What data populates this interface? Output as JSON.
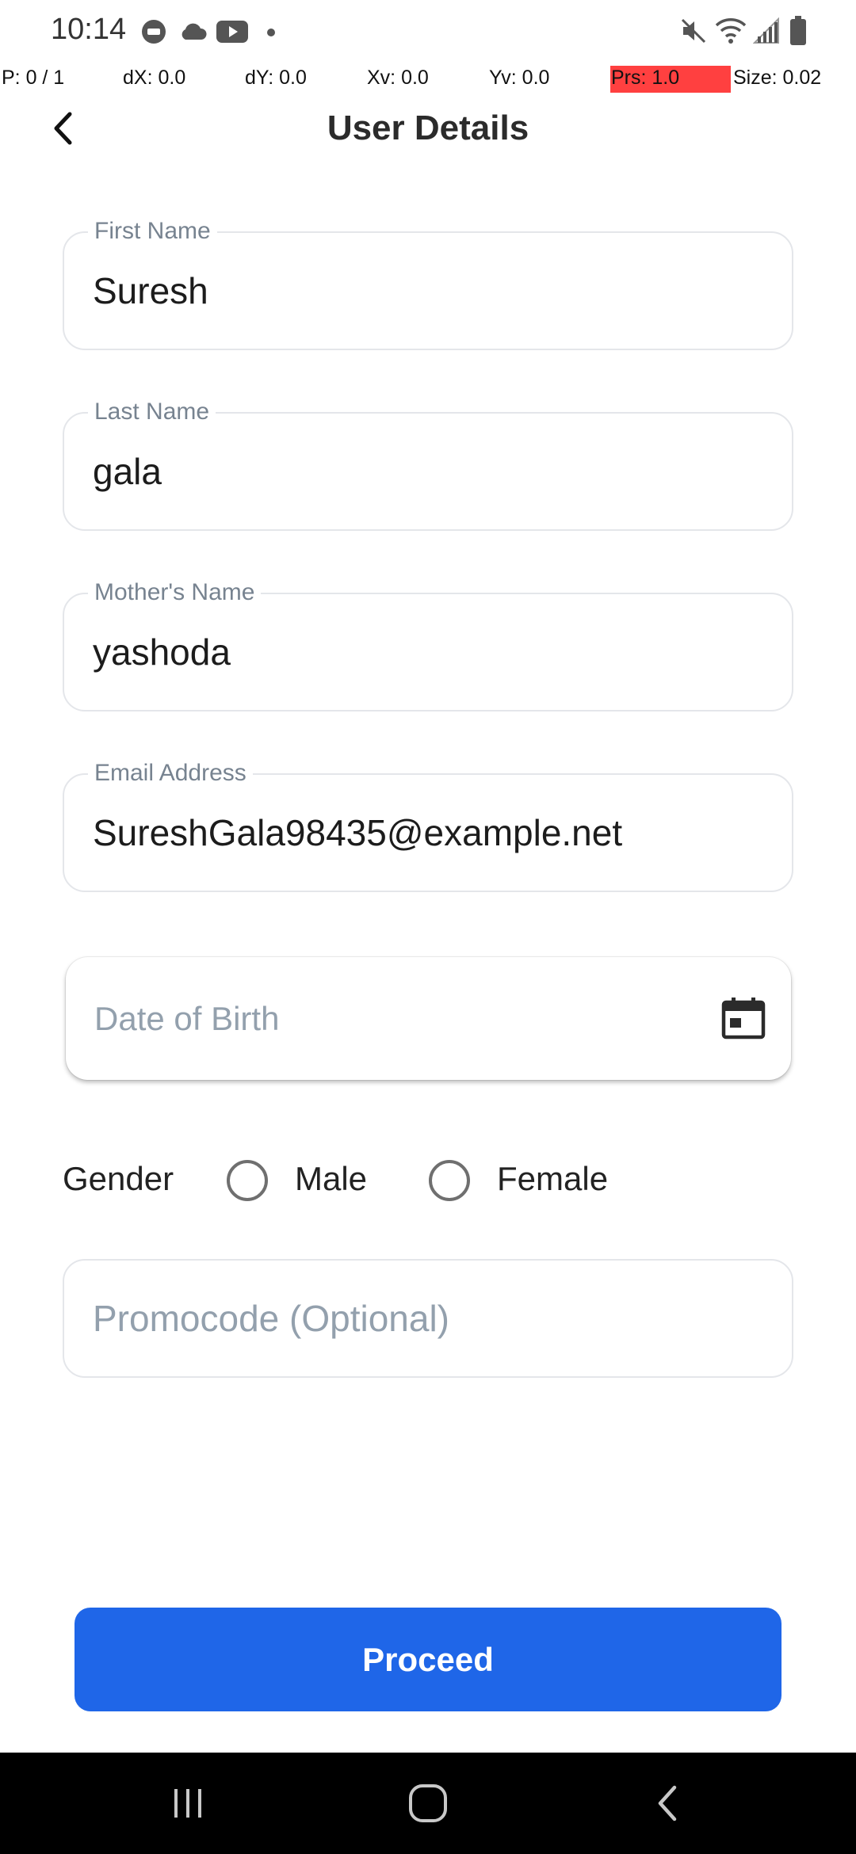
{
  "status_bar": {
    "time": "10:14",
    "left_icons": [
      "paytm-icon",
      "cloud-icon",
      "youtube-icon",
      "dot-icon"
    ],
    "right_icons": [
      "mute-icon",
      "wifi-icon",
      "signal-icon",
      "battery-icon"
    ]
  },
  "pointer_overlay": {
    "p": "P: 0 / 1",
    "dx": "dX: 0.0",
    "dy": "dY: 0.0",
    "xv": "Xv: 0.0",
    "yv": "Yv: 0.0",
    "prs": "Prs: 1.0",
    "size": "Size: 0.02",
    "prs_highlight_color": "#ff4040"
  },
  "header": {
    "title": "User Details",
    "back_icon": "chevron-left-icon"
  },
  "form": {
    "first_name": {
      "label": "First Name",
      "value": "Suresh"
    },
    "last_name": {
      "label": "Last Name",
      "value": "gala"
    },
    "mother_name": {
      "label": "Mother's Name",
      "value": "yashoda"
    },
    "email": {
      "label": "Email Address",
      "value": "SureshGala98435@example.net"
    },
    "dob": {
      "placeholder": "Date of Birth",
      "icon": "calendar-icon"
    },
    "gender": {
      "label": "Gender",
      "options": [
        "Male",
        "Female"
      ],
      "selected": null
    },
    "promocode": {
      "placeholder": "Promocode (Optional)",
      "value": ""
    }
  },
  "actions": {
    "proceed_label": "Proceed",
    "accent_color": "#1f66e8"
  },
  "nav_bar": {
    "buttons": [
      "recents-icon",
      "home-icon",
      "back-icon"
    ]
  }
}
